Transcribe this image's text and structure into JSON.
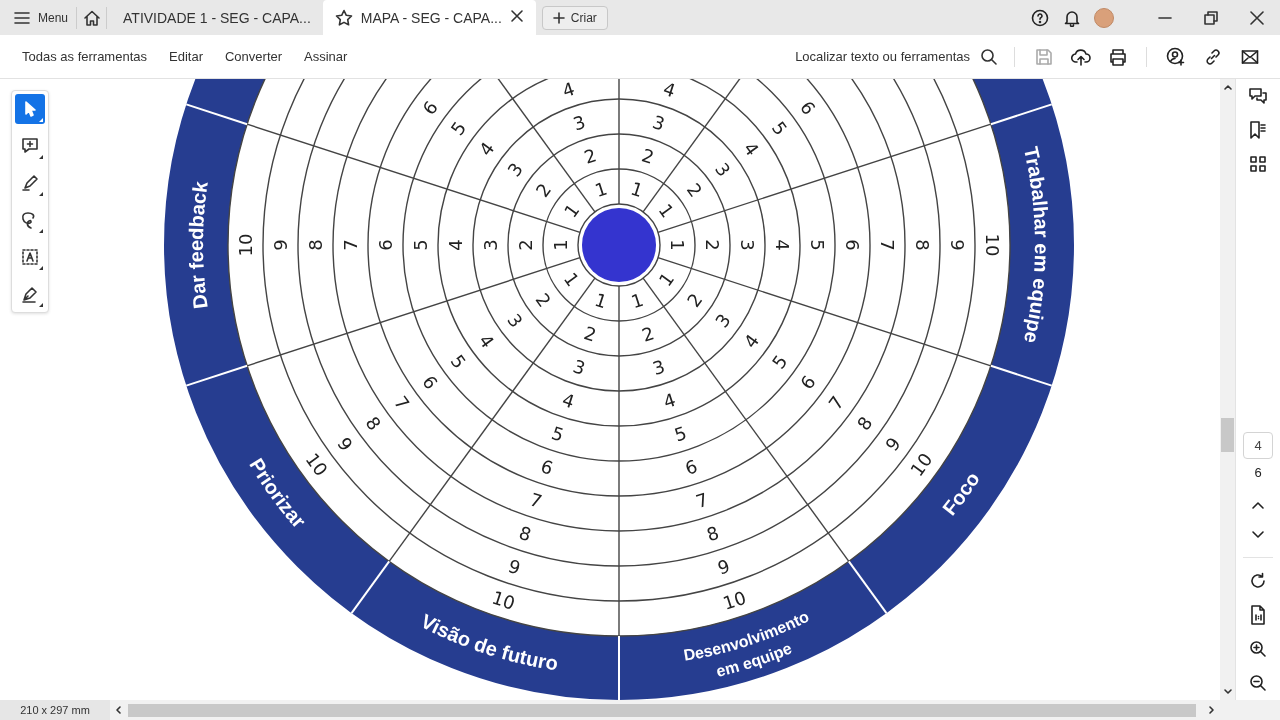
{
  "tab_bar": {
    "menu_label": "Menu",
    "tabs": [
      {
        "label": "ATIVIDADE 1 - SEG - CAPA...",
        "selected": false
      },
      {
        "label": "MAPA - SEG - CAPA...",
        "selected": true
      }
    ],
    "create_button": "Criar"
  },
  "toolbar": {
    "menu_items": [
      "Todas as ferramentas",
      "Editar",
      "Converter",
      "Assinar"
    ],
    "search_label": "Localizar texto ou ferramentas"
  },
  "tool_palette": [
    {
      "kind": "select",
      "selected": true
    },
    {
      "kind": "comment",
      "selected": false
    },
    {
      "kind": "highlight",
      "selected": false
    },
    {
      "kind": "draw",
      "selected": false
    },
    {
      "kind": "text",
      "selected": false
    },
    {
      "kind": "sign",
      "selected": false
    }
  ],
  "document": {
    "wheel": {
      "segments": [
        {
          "numbers": [
            "1",
            "2",
            "3",
            "4",
            "5",
            "6"
          ]
        },
        {
          "numbers": [
            "1",
            "2",
            "3",
            "4"
          ]
        },
        {
          "numbers": [
            "1",
            "2",
            "3",
            "4"
          ]
        },
        {
          "numbers": [
            "1",
            "2",
            "3",
            "4",
            "5",
            "6"
          ]
        },
        {
          "label_lines": [
            "Dar feedback"
          ],
          "numbers": [
            "1",
            "2",
            "3",
            "4",
            "5",
            "6",
            "7",
            "8",
            "9",
            "10"
          ]
        },
        {
          "label_lines": [
            "Priorizar"
          ],
          "numbers": [
            "1",
            "2",
            "3",
            "4",
            "5",
            "6",
            "7",
            "8",
            "9",
            "10"
          ]
        },
        {
          "label_lines": [
            "Visão de futuro"
          ],
          "numbers": [
            "1",
            "2",
            "3",
            "4",
            "5",
            "6",
            "7",
            "8",
            "9",
            "10"
          ]
        },
        {
          "label_lines": [
            "Desenvolvimento",
            "em equipe"
          ],
          "numbers": [
            "1",
            "2",
            "3",
            "4",
            "5",
            "6",
            "7",
            "8",
            "9",
            "10"
          ]
        },
        {
          "label_lines": [
            "Foco"
          ],
          "numbers": [
            "1",
            "2",
            "3",
            "4",
            "5",
            "6",
            "7",
            "8",
            "9",
            "10"
          ]
        },
        {
          "label_lines": [
            "Trabalhar em equipe"
          ],
          "numbers": [
            "1",
            "2",
            "3",
            "4",
            "5",
            "6",
            "7",
            "8",
            "9",
            "10"
          ]
        }
      ]
    }
  },
  "page_nav": {
    "current_page": "4",
    "total_pages": "6"
  },
  "status_bar": {
    "page_size": "210 x 297 mm"
  }
}
